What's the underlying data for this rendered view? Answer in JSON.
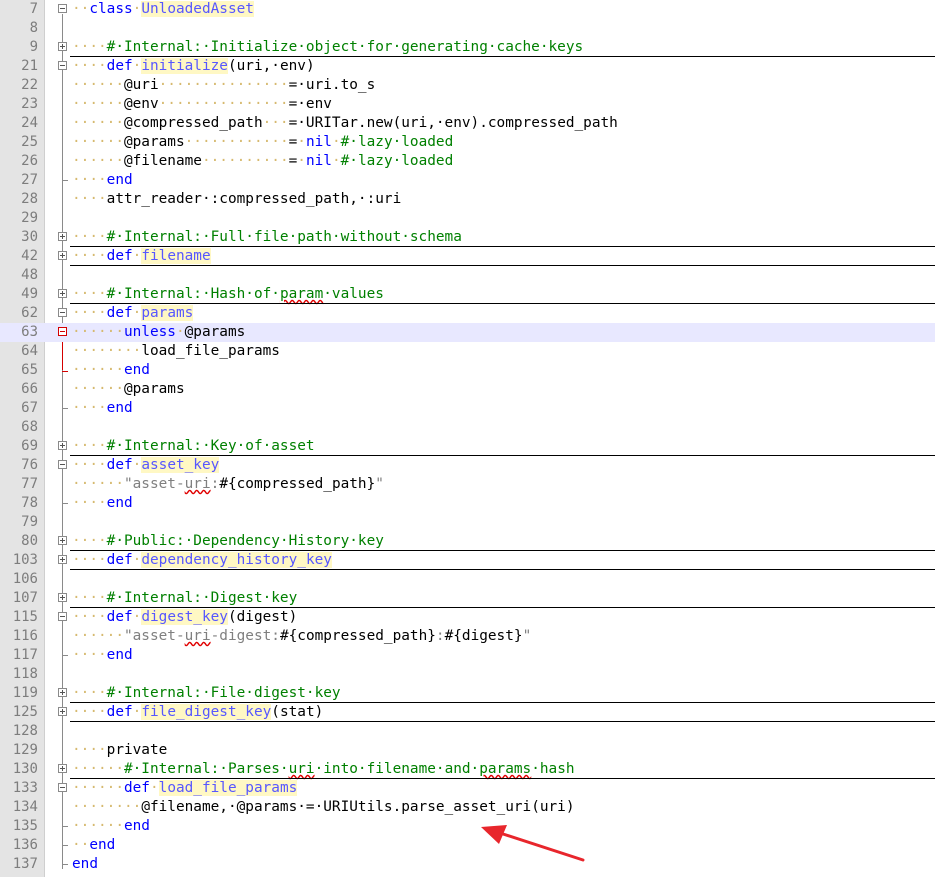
{
  "editor": {
    "language": "ruby",
    "whitespace_dot": "·",
    "colors": {
      "keyword": "#0000ff",
      "comment": "#008000",
      "string": "#808080",
      "definition": "#5757ff",
      "current_line": "#e8e8ff",
      "annotation_arrow": "#e8262c"
    },
    "lines": [
      {
        "n": "7",
        "fold": "minus",
        "segs": [
          [
            "ws",
            "··"
          ],
          [
            "kw",
            "class"
          ],
          [
            "ws",
            "·"
          ],
          [
            "fn",
            "UnloadedAsset"
          ]
        ]
      },
      {
        "n": "8",
        "segs": []
      },
      {
        "n": "9",
        "fold": "plus",
        "folded": true,
        "segs": [
          [
            "ws",
            "····"
          ],
          [
            "cm",
            "#·Internal:·Initialize·object·for·generating·cache·keys"
          ]
        ]
      },
      {
        "n": "21",
        "fold": "minus",
        "segs": [
          [
            "ws",
            "····"
          ],
          [
            "kw",
            "def"
          ],
          [
            "ws",
            "·"
          ],
          [
            "fn",
            "initialize"
          ],
          [
            "",
            "(uri,·env)"
          ]
        ]
      },
      {
        "n": "22",
        "segs": [
          [
            "ws",
            "······"
          ],
          [
            "",
            "@uri"
          ],
          [
            "ws",
            "···············"
          ],
          [
            "",
            "=·uri.to_s"
          ]
        ]
      },
      {
        "n": "23",
        "segs": [
          [
            "ws",
            "······"
          ],
          [
            "",
            "@env"
          ],
          [
            "ws",
            "···············"
          ],
          [
            "",
            "=·env"
          ]
        ]
      },
      {
        "n": "24",
        "segs": [
          [
            "ws",
            "······"
          ],
          [
            "",
            "@compressed_path"
          ],
          [
            "ws",
            "···"
          ],
          [
            "",
            "=·URITar.new(uri,·env).compressed_path"
          ]
        ]
      },
      {
        "n": "25",
        "segs": [
          [
            "ws",
            "······"
          ],
          [
            "",
            "@params"
          ],
          [
            "ws",
            "············"
          ],
          [
            "",
            "="
          ],
          [
            "ws",
            "·"
          ],
          [
            "kw",
            "nil"
          ],
          [
            "ws",
            "·"
          ],
          [
            "cm",
            "#·lazy·loaded"
          ]
        ]
      },
      {
        "n": "26",
        "segs": [
          [
            "ws",
            "······"
          ],
          [
            "",
            "@filename"
          ],
          [
            "ws",
            "··········"
          ],
          [
            "",
            "="
          ],
          [
            "ws",
            "·"
          ],
          [
            "kw",
            "nil"
          ],
          [
            "ws",
            "·"
          ],
          [
            "cm",
            "#·lazy·loaded"
          ]
        ]
      },
      {
        "n": "27",
        "segs": [
          [
            "ws",
            "····"
          ],
          [
            "kw",
            "end"
          ]
        ]
      },
      {
        "n": "28",
        "segs": [
          [
            "ws",
            "····"
          ],
          [
            "",
            "attr_reader·:compressed_path,·:uri"
          ]
        ]
      },
      {
        "n": "29",
        "segs": []
      },
      {
        "n": "30",
        "fold": "plus",
        "folded": true,
        "segs": [
          [
            "ws",
            "····"
          ],
          [
            "cm",
            "#·Internal:·Full·file·path·without·schema"
          ]
        ]
      },
      {
        "n": "42",
        "fold": "plus",
        "folded": true,
        "segs": [
          [
            "ws",
            "····"
          ],
          [
            "kw",
            "def"
          ],
          [
            "ws",
            "·"
          ],
          [
            "fn",
            "filename"
          ]
        ]
      },
      {
        "n": "48",
        "segs": []
      },
      {
        "n": "49",
        "fold": "plus",
        "folded": true,
        "segs": [
          [
            "ws",
            "····"
          ],
          [
            "cm",
            "#·Internal:·Hash·of·"
          ],
          [
            "cm sq",
            "param"
          ],
          [
            "cm",
            "·values"
          ]
        ]
      },
      {
        "n": "62",
        "fold": "minus",
        "segs": [
          [
            "ws",
            "····"
          ],
          [
            "kw",
            "def"
          ],
          [
            "ws",
            "·"
          ],
          [
            "fn",
            "params"
          ]
        ]
      },
      {
        "n": "63",
        "fold": "minus-active",
        "hl": true,
        "segs": [
          [
            "ws",
            "······"
          ],
          [
            "kw",
            "unless"
          ],
          [
            "ws",
            "·"
          ],
          [
            "",
            "@params"
          ]
        ]
      },
      {
        "n": "64",
        "segs": [
          [
            "ws",
            "········"
          ],
          [
            "",
            "load_file_params"
          ]
        ]
      },
      {
        "n": "65",
        "segs": [
          [
            "ws",
            "······"
          ],
          [
            "kw",
            "end"
          ]
        ]
      },
      {
        "n": "66",
        "segs": [
          [
            "ws",
            "······"
          ],
          [
            "",
            "@params"
          ]
        ]
      },
      {
        "n": "67",
        "segs": [
          [
            "ws",
            "····"
          ],
          [
            "kw",
            "end"
          ]
        ]
      },
      {
        "n": "68",
        "segs": []
      },
      {
        "n": "69",
        "fold": "plus",
        "folded": true,
        "segs": [
          [
            "ws",
            "····"
          ],
          [
            "cm",
            "#·Internal:·Key·of·asset"
          ]
        ]
      },
      {
        "n": "76",
        "fold": "minus",
        "segs": [
          [
            "ws",
            "····"
          ],
          [
            "kw",
            "def"
          ],
          [
            "ws",
            "·"
          ],
          [
            "fn",
            "asset_key"
          ]
        ]
      },
      {
        "n": "77",
        "segs": [
          [
            "ws",
            "······"
          ],
          [
            "st",
            "\"asset-"
          ],
          [
            "st sq",
            "uri"
          ],
          [
            "st",
            ":"
          ],
          [
            "",
            "#{compressed_path}"
          ],
          [
            "st",
            "\""
          ]
        ]
      },
      {
        "n": "78",
        "segs": [
          [
            "ws",
            "····"
          ],
          [
            "kw",
            "end"
          ]
        ]
      },
      {
        "n": "79",
        "segs": []
      },
      {
        "n": "80",
        "fold": "plus",
        "folded": true,
        "segs": [
          [
            "ws",
            "····"
          ],
          [
            "cm",
            "#·Public:·Dependency·History·key"
          ]
        ]
      },
      {
        "n": "103",
        "fold": "plus",
        "folded": true,
        "segs": [
          [
            "ws",
            "····"
          ],
          [
            "kw",
            "def"
          ],
          [
            "ws",
            "·"
          ],
          [
            "fn",
            "dependency_history_key"
          ]
        ]
      },
      {
        "n": "106",
        "segs": []
      },
      {
        "n": "107",
        "fold": "plus",
        "folded": true,
        "segs": [
          [
            "ws",
            "····"
          ],
          [
            "cm",
            "#·Internal:·Digest·key"
          ]
        ]
      },
      {
        "n": "115",
        "fold": "minus",
        "segs": [
          [
            "ws",
            "····"
          ],
          [
            "kw",
            "def"
          ],
          [
            "ws",
            "·"
          ],
          [
            "fn",
            "digest_key"
          ],
          [
            "",
            "(digest)"
          ]
        ]
      },
      {
        "n": "116",
        "segs": [
          [
            "ws",
            "······"
          ],
          [
            "st",
            "\"asset-"
          ],
          [
            "st sq",
            "uri"
          ],
          [
            "st",
            "-digest:"
          ],
          [
            "",
            "#{compressed_path}"
          ],
          [
            "st",
            ":"
          ],
          [
            "",
            "#{digest}"
          ],
          [
            "st",
            "\""
          ]
        ]
      },
      {
        "n": "117",
        "segs": [
          [
            "ws",
            "····"
          ],
          [
            "kw",
            "end"
          ]
        ]
      },
      {
        "n": "118",
        "segs": []
      },
      {
        "n": "119",
        "fold": "plus",
        "folded": true,
        "segs": [
          [
            "ws",
            "····"
          ],
          [
            "cm",
            "#·Internal:·File·digest·key"
          ]
        ]
      },
      {
        "n": "125",
        "fold": "plus",
        "folded": true,
        "segs": [
          [
            "ws",
            "····"
          ],
          [
            "kw",
            "def"
          ],
          [
            "ws",
            "·"
          ],
          [
            "fn",
            "file_digest_key"
          ],
          [
            "",
            "(stat)"
          ]
        ]
      },
      {
        "n": "128",
        "segs": []
      },
      {
        "n": "129",
        "segs": [
          [
            "ws",
            "····"
          ],
          [
            "",
            "private"
          ]
        ]
      },
      {
        "n": "130",
        "fold": "plus",
        "folded": true,
        "segs": [
          [
            "ws",
            "······"
          ],
          [
            "cm",
            "#·Internal:·Parses·"
          ],
          [
            "cm sq",
            "uri"
          ],
          [
            "cm",
            "·into·filename·and·"
          ],
          [
            "cm sq",
            "params"
          ],
          [
            "cm",
            "·hash"
          ]
        ]
      },
      {
        "n": "133",
        "fold": "minus",
        "segs": [
          [
            "ws",
            "······"
          ],
          [
            "kw",
            "def"
          ],
          [
            "ws",
            "·"
          ],
          [
            "fn",
            "load_file_params"
          ]
        ]
      },
      {
        "n": "134",
        "segs": [
          [
            "ws",
            "········"
          ],
          [
            "",
            "@filename,·@params·=·URIUtils.parse_asset_uri(uri)"
          ]
        ]
      },
      {
        "n": "135",
        "segs": [
          [
            "ws",
            "······"
          ],
          [
            "kw",
            "end"
          ]
        ]
      },
      {
        "n": "136",
        "segs": [
          [
            "ws",
            "··"
          ],
          [
            "kw",
            "end"
          ]
        ]
      },
      {
        "n": "137",
        "segs": [
          [
            "kw",
            "end"
          ]
        ]
      }
    ]
  }
}
